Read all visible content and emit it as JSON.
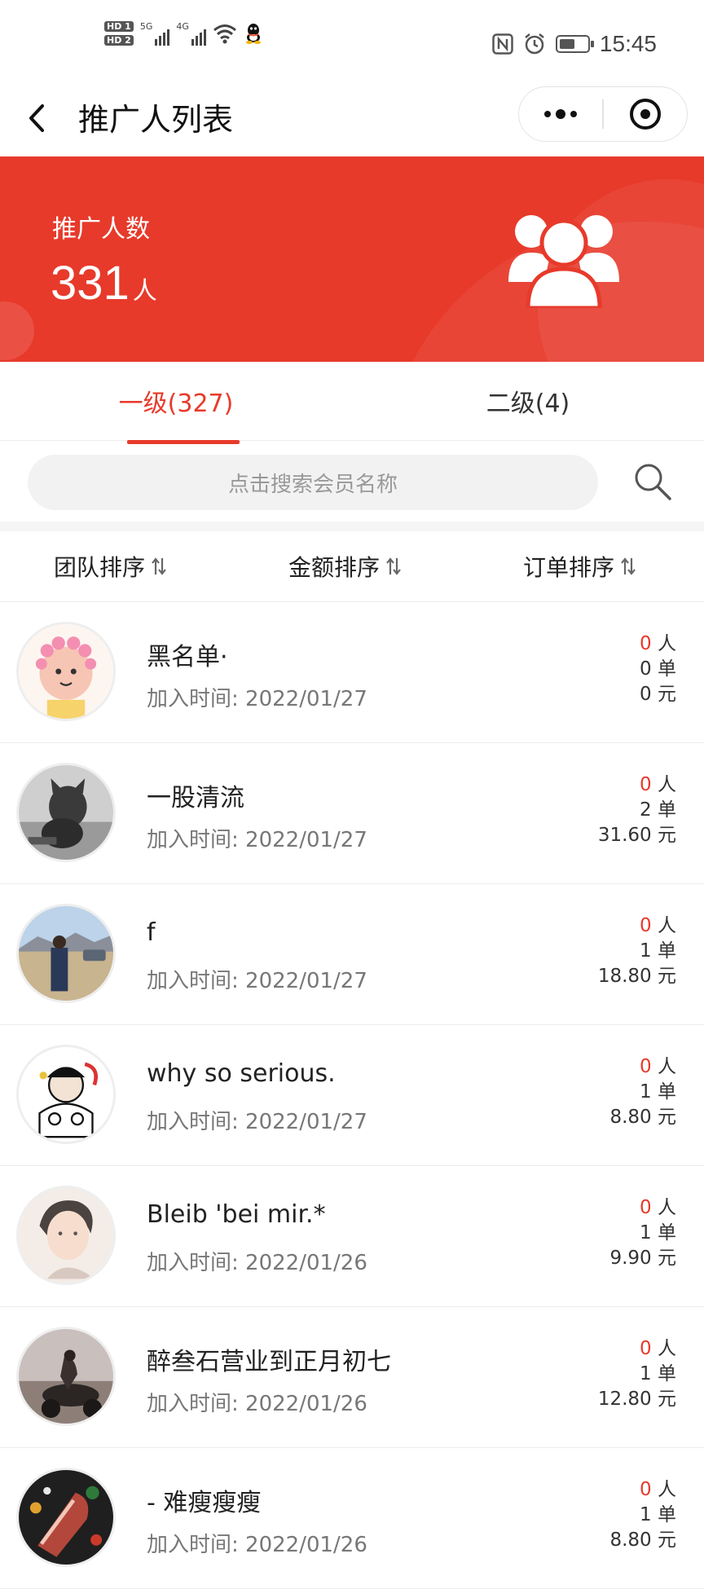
{
  "status_bar": {
    "hd1": "HD 1",
    "hd2": "HD 2",
    "net1": "5G",
    "net2": "4G",
    "time": "15:45",
    "battery_level": 0.55,
    "icons": [
      "signal-icon",
      "wifi-icon",
      "qq-icon",
      "nfc-icon",
      "alarm-icon",
      "battery-icon"
    ]
  },
  "nav": {
    "title": "推广人列表",
    "back_icon": "chevron-left-icon",
    "more_icon": "more-dots-icon",
    "close_icon": "target-close-icon"
  },
  "banner": {
    "label": "推广人数",
    "count": "331",
    "unit": "人",
    "icon": "users-group-icon",
    "bg_color": "#e73a2b"
  },
  "tabs": [
    {
      "label": "一级(327)",
      "active": true
    },
    {
      "label": "二级(4)",
      "active": false
    }
  ],
  "search": {
    "placeholder": "点击搜索会员名称",
    "icon": "search-icon"
  },
  "sort": [
    {
      "label": "团队排序",
      "icon": "sort-icon"
    },
    {
      "label": "金额排序",
      "icon": "sort-icon"
    },
    {
      "label": "订单排序",
      "icon": "sort-icon"
    }
  ],
  "members": [
    {
      "name": "黑名单·",
      "joined": "加入时间: 2022/01/27",
      "people": "0",
      "people_unit": "人",
      "orders": "0 单",
      "amount": "0 元"
    },
    {
      "name": "一股清流",
      "joined": "加入时间: 2022/01/27",
      "people": "0",
      "people_unit": "人",
      "orders": "2 单",
      "amount": "31.60 元"
    },
    {
      "name": "f",
      "joined": "加入时间: 2022/01/27",
      "people": "0",
      "people_unit": "人",
      "orders": "1 单",
      "amount": "18.80 元"
    },
    {
      "name": "why so serious.",
      "joined": "加入时间: 2022/01/27",
      "people": "0",
      "people_unit": "人",
      "orders": "1 单",
      "amount": "8.80 元"
    },
    {
      "name": "Bleib 'bei mir.*",
      "joined": "加入时间: 2022/01/26",
      "people": "0",
      "people_unit": "人",
      "orders": "1 单",
      "amount": "9.90 元"
    },
    {
      "name": "醉叁石营业到正月初七",
      "joined": "加入时间: 2022/01/26",
      "people": "0",
      "people_unit": "人",
      "orders": "1 单",
      "amount": "12.80 元"
    },
    {
      "name": "- 难瘦瘦瘦",
      "joined": "加入时间: 2022/01/26",
      "people": "0",
      "people_unit": "人",
      "orders": "1 单",
      "amount": "8.80 元"
    }
  ],
  "colors": {
    "accent": "#e73a2b",
    "text": "#333333",
    "muted": "#777777"
  }
}
